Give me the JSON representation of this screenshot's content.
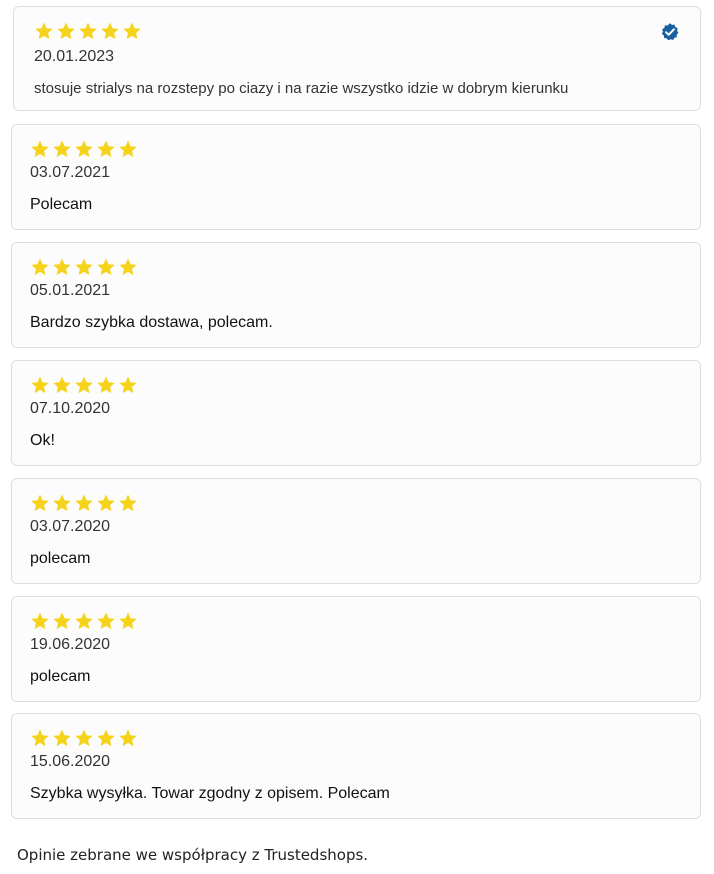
{
  "star_color": "#f5d31b",
  "verified_color": "#1a5fa0",
  "reviews": [
    {
      "rating": 5,
      "date": "20.01.2023",
      "text": "stosuje strialys na rozstepy po ciazy i na razie wszystko idzie w dobrym kierunku",
      "verified": true,
      "verified_icon": "verified-badge-icon"
    },
    {
      "rating": 5,
      "date": "03.07.2021",
      "text": "Polecam"
    },
    {
      "rating": 5,
      "date": "05.01.2021",
      "text": "Bardzo szybka dostawa, polecam."
    },
    {
      "rating": 5,
      "date": "07.10.2020",
      "text": "Ok!"
    },
    {
      "rating": 5,
      "date": "03.07.2020",
      "text": "polecam"
    },
    {
      "rating": 5,
      "date": "19.06.2020",
      "text": "polecam"
    },
    {
      "rating": 5,
      "date": "15.06.2020",
      "text": "Szybka wysyłka. Towar zgodny z opisem. Polecam"
    }
  ],
  "footer": {
    "text": "Opinie zebrane we współpracy z Trustedshops."
  }
}
